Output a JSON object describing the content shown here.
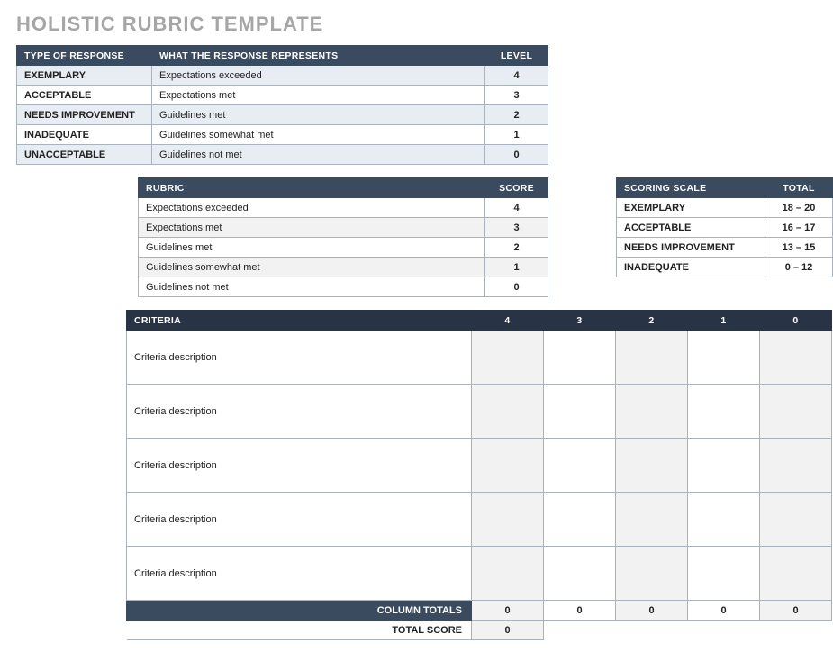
{
  "title": "HOLISTIC RUBRIC TEMPLATE",
  "responseTable": {
    "headers": {
      "type": "TYPE OF RESPONSE",
      "represents": "WHAT THE RESPONSE REPRESENTS",
      "level": "LEVEL"
    },
    "rows": [
      {
        "type": "EXEMPLARY",
        "represents": "Expectations exceeded",
        "level": "4"
      },
      {
        "type": "ACCEPTABLE",
        "represents": "Expectations met",
        "level": "3"
      },
      {
        "type": "NEEDS IMPROVEMENT",
        "represents": "Guidelines met",
        "level": "2"
      },
      {
        "type": "INADEQUATE",
        "represents": "Guidelines somewhat met",
        "level": "1"
      },
      {
        "type": "UNACCEPTABLE",
        "represents": "Guidelines not met",
        "level": "0"
      }
    ]
  },
  "rubricTable": {
    "headers": {
      "rubric": "RUBRIC",
      "score": "SCORE"
    },
    "rows": [
      {
        "rubric": "Expectations exceeded",
        "score": "4"
      },
      {
        "rubric": "Expectations met",
        "score": "3"
      },
      {
        "rubric": "Guidelines met",
        "score": "2"
      },
      {
        "rubric": "Guidelines somewhat met",
        "score": "1"
      },
      {
        "rubric": "Guidelines not met",
        "score": "0"
      }
    ]
  },
  "scoringScale": {
    "headers": {
      "scale": "SCORING SCALE",
      "total": "TOTAL"
    },
    "rows": [
      {
        "scale": "EXEMPLARY",
        "total": "18 – 20"
      },
      {
        "scale": "ACCEPTABLE",
        "total": "16 – 17"
      },
      {
        "scale": "NEEDS IMPROVEMENT",
        "total": "13 – 15"
      },
      {
        "scale": "INADEQUATE",
        "total": "0 – 12"
      }
    ]
  },
  "criteriaTable": {
    "header": "CRITERIA",
    "columns": [
      "4",
      "3",
      "2",
      "1",
      "0"
    ],
    "rows": [
      {
        "desc": "Criteria description"
      },
      {
        "desc": "Criteria description"
      },
      {
        "desc": "Criteria description"
      },
      {
        "desc": "Criteria description"
      },
      {
        "desc": "Criteria description"
      }
    ],
    "columnTotalsLabel": "COLUMN TOTALS",
    "columnTotals": [
      "0",
      "0",
      "0",
      "0",
      "0"
    ],
    "totalScoreLabel": "TOTAL SCORE",
    "totalScore": "0"
  }
}
